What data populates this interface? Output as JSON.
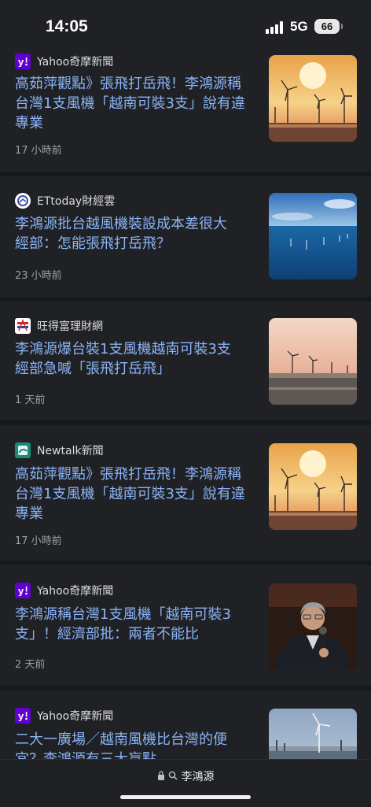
{
  "status_bar": {
    "time": "14:05",
    "network": "5G",
    "battery": "66"
  },
  "articles": [
    {
      "source": "Yahoo奇摩新聞",
      "logo": "yahoo-logo",
      "headline": "高茹萍觀點》張飛打岳飛！李鴻源稱台灣1支風機「越南可裝3支」說有違專業",
      "age": "17 小時前",
      "thumbnail": "sunset-wind-turbines"
    },
    {
      "source": "ETtoday財經雲",
      "logo": "ettoday-logo",
      "headline": "李鴻源批台越風機裝設成本差很大　經部：怎能張飛打岳飛？",
      "age": "23 小時前",
      "thumbnail": "offshore-wind-farm-sea"
    },
    {
      "source": "旺得富理財網",
      "logo": "wantrich-logo",
      "headline": "李鴻源爆台裝1支風機越南可裝3支　經部急喊「張飛打岳飛」",
      "age": "1 天前",
      "thumbnail": "coastal-wind-turbines-dusk"
    },
    {
      "source": "Newtalk新聞",
      "logo": "newtalk-logo",
      "headline": "高茹萍觀點》張飛打岳飛！李鴻源稱台灣1支風機「越南可裝3支」說有違專業",
      "age": "17 小時前",
      "thumbnail": "sunset-wind-turbines"
    },
    {
      "source": "Yahoo奇摩新聞",
      "logo": "yahoo-logo",
      "headline": "李鴻源稱台灣1支風機「越南可裝3支」！經濟部批：兩者不能比",
      "age": "2 天前",
      "thumbnail": "speaker-with-microphone"
    },
    {
      "source": "Yahoo奇摩新聞",
      "logo": "yahoo-logo",
      "headline": "二大一廣場／越南風機比台灣的便宜？李鴻源有三大盲點",
      "age": "",
      "thumbnail": "wind-turbine-harbor"
    }
  ],
  "bottom_bar": {
    "url": "李鴻源"
  },
  "colors": {
    "headline": "#8ab4f8",
    "card": "#202124",
    "background": "#17181b",
    "yahoo": "#5f01d1"
  }
}
